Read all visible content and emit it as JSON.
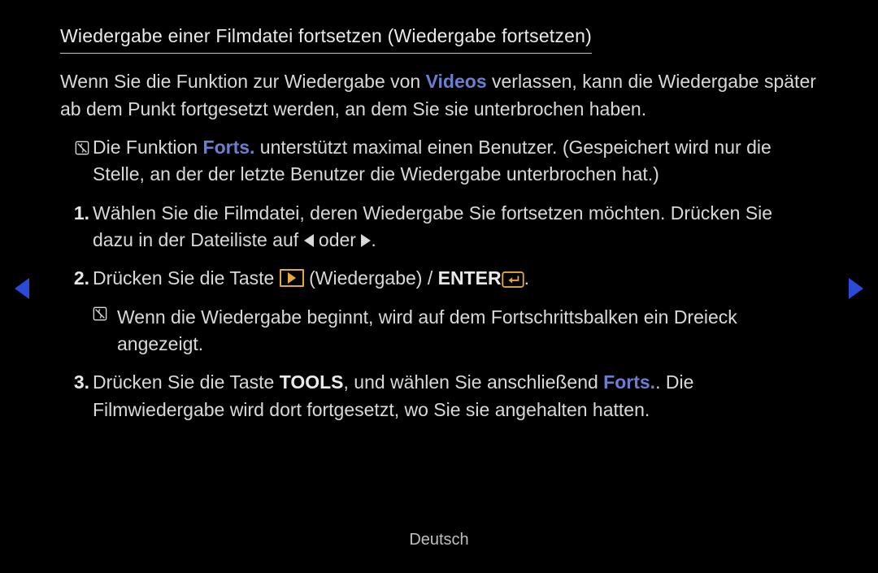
{
  "title": "Wiedergabe einer Filmdatei fortsetzen (Wiedergabe fortsetzen)",
  "intro": {
    "part1": "Wenn Sie die Funktion zur Wiedergabe von ",
    "highlight": "Videos",
    "part2": " verlassen, kann die Wiedergabe später ab dem Punkt fortgesetzt werden, an dem Sie sie unterbrochen haben."
  },
  "note1": {
    "part1": "Die Funktion ",
    "highlight": "Forts.",
    "part2": " unterstützt maximal einen Benutzer. (Gespeichert wird nur die Stelle, an der der letzte Benutzer die Wiedergabe unterbrochen hat.)"
  },
  "steps": {
    "one": {
      "marker": "1.",
      "part1": "Wählen Sie die Filmdatei, deren Wiedergabe Sie fortsetzen möchten. Drücken Sie dazu in der Dateiliste auf ",
      "or": " oder ",
      "end": "."
    },
    "two": {
      "marker": "2.",
      "part1": "Drücken Sie die Taste ",
      "part2": " (Wiedergabe) / ",
      "enter": "ENTER",
      "end": ".",
      "note": "Wenn die Wiedergabe beginnt, wird auf dem Fortschrittsbalken ein Dreieck angezeigt."
    },
    "three": {
      "marker": "3.",
      "part1": "Drücken Sie die Taste ",
      "tools": "TOOLS",
      "part2": ", und wählen Sie anschließend ",
      "highlight": "Forts.",
      "part3": ". Die Filmwiedergabe wird dort fortgesetzt, wo Sie sie angehalten hatten."
    }
  },
  "footer": "Deutsch"
}
